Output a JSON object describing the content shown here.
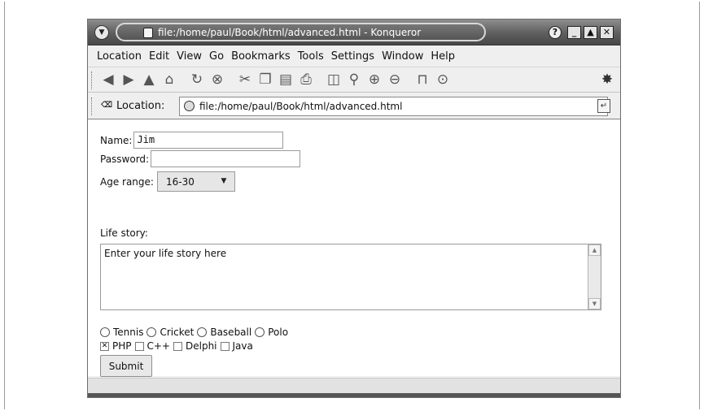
{
  "window": {
    "title": "file:/home/paul/Book/html/advanced.html - Konqueror",
    "buttons": {
      "help": "?",
      "minimize": "_",
      "maximize": "▲",
      "close": "✕"
    }
  },
  "menubar": {
    "items": [
      "Location",
      "Edit",
      "View",
      "Go",
      "Bookmarks",
      "Tools",
      "Settings",
      "Window",
      "Help"
    ]
  },
  "toolbar": {
    "icons": [
      "back-icon",
      "forward-icon",
      "up-icon",
      "home-icon",
      "reload-icon",
      "stop-icon",
      "cut-icon",
      "copy-icon",
      "paste-icon",
      "print-icon",
      "new-window-icon",
      "zoom-icon",
      "zoom-in-icon",
      "zoom-out-icon",
      "lock-icon",
      "download-icon",
      "throbber-icon"
    ]
  },
  "location": {
    "label": "Location:",
    "url": "file:/home/paul/Book/html/advanced.html"
  },
  "form": {
    "name_label": "Name:",
    "name_value": "Jim",
    "password_label": "Password:",
    "password_value": "",
    "age_label": "Age range:",
    "age_value": "16-30",
    "story_label": "Life story:",
    "story_value": "Enter your life story here",
    "radios": [
      {
        "label": "Tennis",
        "checked": false
      },
      {
        "label": "Cricket",
        "checked": false
      },
      {
        "label": "Baseball",
        "checked": false
      },
      {
        "label": "Polo",
        "checked": false
      }
    ],
    "checkboxes": [
      {
        "label": "PHP",
        "checked": true
      },
      {
        "label": "C++",
        "checked": false
      },
      {
        "label": "Delphi",
        "checked": false
      },
      {
        "label": "Java",
        "checked": false
      }
    ],
    "submit_label": "Submit"
  }
}
